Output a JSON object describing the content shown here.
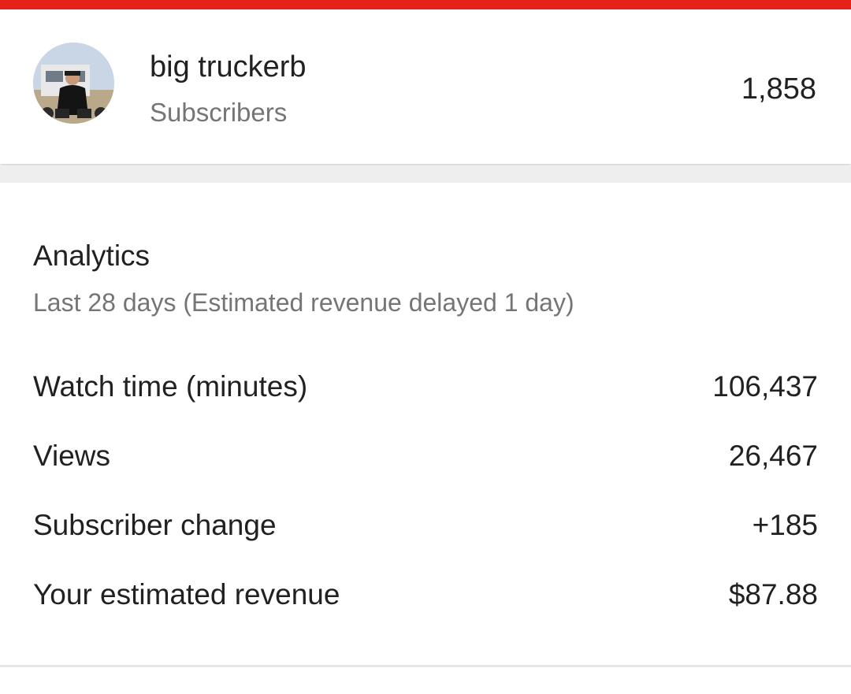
{
  "status_bar": {
    "color": "#e62117"
  },
  "channel": {
    "name": "big truckerb",
    "subscribers_label": "Subscribers",
    "subscriber_count": "1,858",
    "avatar_icon": "channel-avatar-photo"
  },
  "analytics": {
    "title": "Analytics",
    "subtitle": "Last 28 days (Estimated revenue delayed 1 day)",
    "metrics": [
      {
        "label": "Watch time (minutes)",
        "value": "106,437"
      },
      {
        "label": "Views",
        "value": "26,467"
      },
      {
        "label": "Subscriber change",
        "value": "+185"
      },
      {
        "label": "Your estimated revenue",
        "value": "$87.88"
      }
    ]
  }
}
